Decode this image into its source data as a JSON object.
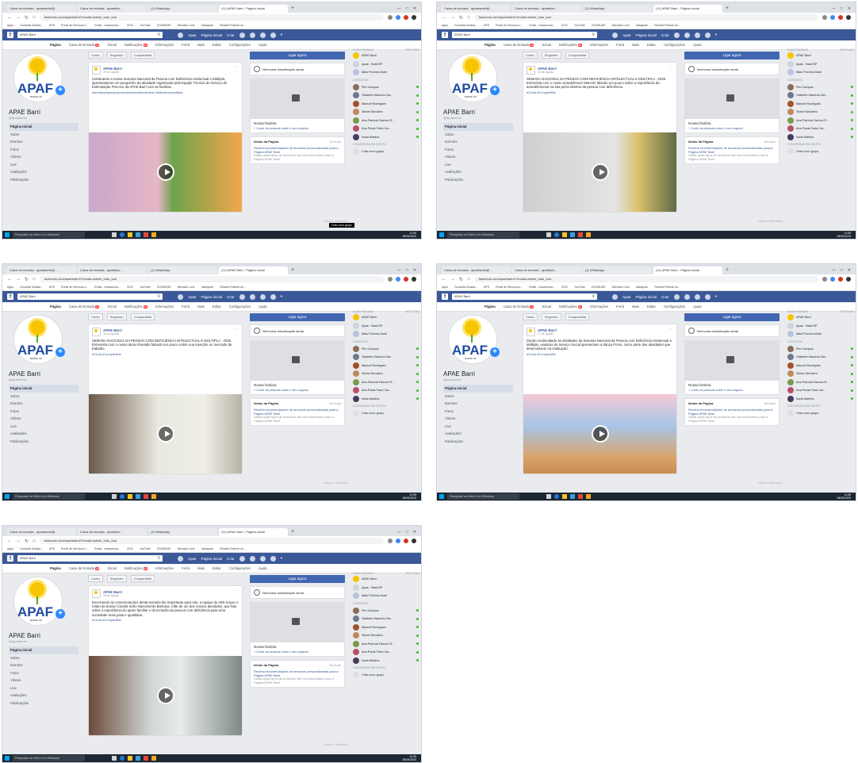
{
  "browser": {
    "tabs": [
      {
        "label": "Caixa de entrada - apaebarirri@..."
      },
      {
        "label": "Caixa de entrada - apaefisio..."
      },
      {
        "label": "(1) WhatsApp"
      },
      {
        "label": "(11) APAE Barri - Página inicial"
      }
    ],
    "new_tab": "+",
    "url": "facebook.com/apaebarirri/?modal=admin_todo_tour",
    "bookmarks": [
      "Apps",
      "Consulta Guiada...",
      "APS",
      "Portal de Serviços e...",
      "Email - cmasconsa...",
      "CEIC",
      "YouTube",
      "ZOOMUSE",
      "Mercado Livre",
      "Instagram",
      "Receita Federal do..."
    ]
  },
  "facebook": {
    "logo": "f",
    "search_value": "APAE Barri",
    "nav": [
      "Apae",
      "Página inicial",
      "Criar"
    ],
    "page_tabs": [
      "Página",
      "Caixa de Entrada",
      "Sócial",
      "Notificações",
      "Informações",
      "Ferrâ",
      "Mais",
      "Editar",
      "Configurações",
      "Ajuda"
    ],
    "badge_inbox": "20",
    "badge_notif": "99",
    "page_name": "APAE Barri",
    "page_handle": "@apaebarirri",
    "logo_text": "APAF",
    "logo_sub": "BARIRI SP",
    "left_nav": [
      "Página inicial",
      "Sobre",
      "Eventos",
      "Fotos",
      "Vídeos",
      "Live",
      "Avaliações",
      "Publicações"
    ],
    "actions": [
      "Curtiu",
      "Seguindo",
      "Compartilhar"
    ],
    "help_button": "Ligar agora",
    "rating": "Nenhuma classificação ainda",
    "story_title": "Nossa história",
    "story_link": "+ Conte às pessoas sobre o seu negócio",
    "ideas_title": "Ideias da Página",
    "ideas_more": "Ver tudo",
    "ideas_text": "Receba recomendações de anúncios personalizadas para a Página APAE Barri",
    "ideas_gray": "Saiba quais tipos de anúncios são recomendados para a Página APAE Barri",
    "far_headers": [
      "SUAS PÁGINAS",
      "VER TUDO"
    ],
    "far_pages": [
      "APAE Barri",
      "Apae - Barri/SP",
      "Mais Próximo Barri"
    ],
    "contacts_label": "CONTATOS",
    "contacts": [
      "Pim Campos",
      "Olaberte Maurício Ma...",
      "Manuel Rodrigues",
      "Sidnei Sendeiro",
      "Ana Patrícia Fantoni R...",
      "Ana Paula Faria Car...",
      "Karla Martins"
    ],
    "groups_label": "CONVERSAS EM GRUPO",
    "create_group": "Criar novo grupo"
  },
  "posts": [
    {
      "author": "APAE Barri",
      "date": "25 de agosto",
      "text": "Celebrando a nossa Semana Nacional da Pessoa com Deficiência Intelectual e Múltipla, apresentamos um pouquinho da atividade organizada pela Equipe Técnica do Serviço de Estimulação Precoce da APAE Barri com as famílias.",
      "tags": "#semanadapessoacomdeficienciaintelectual #deficienciamultipla"
    },
    {
      "author": "APAE Barri",
      "date": "26 de agosto",
      "text": "SEMANA NACIONAL DA PESSOA COM DEFICIÊNCIA INTELECTUAL E MÚLTIPLA - 2020. Entrevista com o nosso autodefensor Marcelo falando um pouco sobre a importância da autodefensoria na luta pelos direitos da pessoa com deficiência.",
      "tags": "#Curta #Compartilhe"
    },
    {
      "author": "APAE Barri",
      "date": "26 de agosto",
      "text": "SEMANA NACIONAL DA PESSOA COM DEFICIÊNCIA INTELECTUAL E MÚLTIPLA - 2020. Entrevista com o nosso aluno Ronaldo falando um pouco sobre sua inserção no mercado de trabalho.",
      "tags": "#Curta #Compartilhe"
    },
    {
      "author": "APAE Barri",
      "date": "27 de agosto",
      "text": "Dando continuidade às atividades da Semana Nacional da Pessoa com Deficiência Intelectual e Múltipla, usuários do Serviço Social apresentam a dança Frevo, como parte das atividades que desenvolvem na instituição.",
      "tags": "#Curta #Compartilhe"
    },
    {
      "author": "APAE Barri",
      "date": "28 de agosto",
      "text": "Encerrando as comemorações desta semana tão importante para nós, a equipe do AEE trouxe o relato de Evelyn Camila Sotto Nascimento Barbosa, mãe de um dos nossos atendidos, que fala sobre a importância do apoio familiar e da inclusão da pessoa com deficiência para uma sociedade mais justa e igualitária.",
      "tags": "#Curta #Compartilhe"
    }
  ],
  "taskbar": {
    "search": "Pesquisar na Web e no Windows",
    "time": "11:05",
    "date": "08/09/2020"
  },
  "tooltip": "Criar novo grupo",
  "watermark": "Ativar o Windows",
  "colors": {
    "facebook_blue": "#3b5998",
    "button_blue": "#4267b2",
    "taskbar": "#1c2733",
    "online": "#42b72a"
  }
}
